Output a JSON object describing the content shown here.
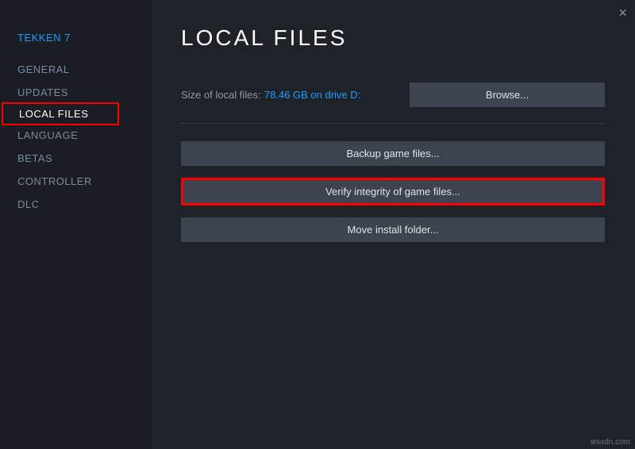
{
  "game_title": "TEKKEN 7",
  "nav": {
    "items": [
      "GENERAL",
      "UPDATES",
      "LOCAL FILES",
      "LANGUAGE",
      "BETAS",
      "CONTROLLER",
      "DLC"
    ],
    "active_index": 2
  },
  "page": {
    "title": "LOCAL FILES",
    "size_label": "Size of local files:",
    "size_value": "78.46 GB on drive D:",
    "browse_label": "Browse...",
    "backup_label": "Backup game files...",
    "verify_label": "Verify integrity of game files...",
    "move_label": "Move install folder..."
  },
  "close_symbol": "×",
  "watermark": "wsxdn.com"
}
